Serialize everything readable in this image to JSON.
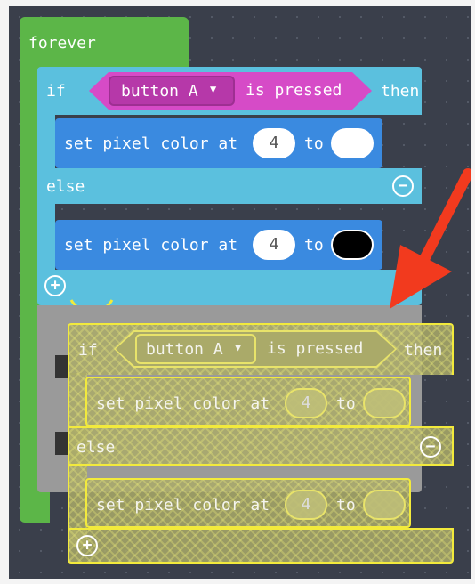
{
  "forever": {
    "label": "forever"
  },
  "if_block": {
    "if_label": "if",
    "condition": {
      "dropdown_value": "button A",
      "suffix": "is pressed"
    },
    "then_label": "then",
    "else_label": "else",
    "then_stmt": {
      "label": "set pixel color at",
      "index": "4",
      "to_label": "to",
      "color": "#ffffff"
    },
    "else_stmt": {
      "label": "set pixel color at",
      "index": "4",
      "to_label": "to",
      "color": "#000000"
    }
  },
  "ghost_block": {
    "if_label": "if",
    "condition": {
      "dropdown_value": "button A",
      "suffix": "is pressed"
    },
    "then_label": "then",
    "else_label": "else",
    "then_stmt": {
      "label": "set pixel color at",
      "index": "4",
      "to_label": "to"
    },
    "else_stmt": {
      "label": "set pixel color at",
      "index": "4",
      "to_label": "to"
    }
  },
  "colors": {
    "forever_green": "#5cb648",
    "logic_cyan": "#5bc0de",
    "led_blue": "#3a8ae0",
    "input_magenta": "#d64bc7",
    "arrow_red": "#f23a1e",
    "ghost_outline": "#f2ea3c"
  }
}
